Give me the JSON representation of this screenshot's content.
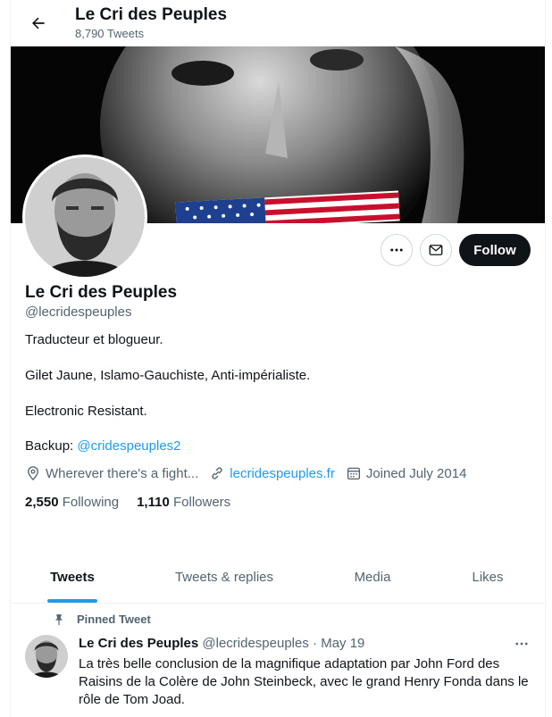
{
  "header": {
    "title": "Le Cri des Peuples",
    "tweet_count": "8,790 Tweets",
    "back_icon": "arrow-left-icon"
  },
  "profile": {
    "name": "Le Cri des Peuples",
    "handle": "@lecridespeuples",
    "follow_label": "Follow",
    "bio": {
      "line1": "Traducteur et blogueur.",
      "line2": "Gilet Jaune, Islamo-Gauchiste, Anti-impérialiste.",
      "line3": "Electronic Resistant.",
      "backup_prefix": "Backup: ",
      "backup_link": "@cridespeuples2"
    },
    "location": "Wherever there's a fight...",
    "website": "lecridespeuples.fr",
    "joined": "Joined July 2014",
    "following_count": "2,550",
    "following_label": "Following",
    "followers_count": "1,110",
    "followers_label": "Followers"
  },
  "tabs": [
    {
      "label": "Tweets",
      "active": true
    },
    {
      "label": "Tweets & replies",
      "active": false
    },
    {
      "label": "Media",
      "active": false
    },
    {
      "label": "Likes",
      "active": false
    }
  ],
  "pinned_tweet": {
    "pinned_label": "Pinned Tweet",
    "author_name": "Le Cri des Peuples",
    "author_handle": "@lecridespeuples",
    "separator": "·",
    "date": "May 19",
    "text": "La très belle conclusion de la magnifique adaptation par John Ford des Raisins de la Colère de John Steinbeck, avec le grand Henry Fonda dans le rôle de Tom Joad."
  },
  "colors": {
    "accent": "#1d9bf0",
    "text_primary": "#0f1419",
    "text_secondary": "#536471",
    "follow_bg": "#0f1419"
  }
}
